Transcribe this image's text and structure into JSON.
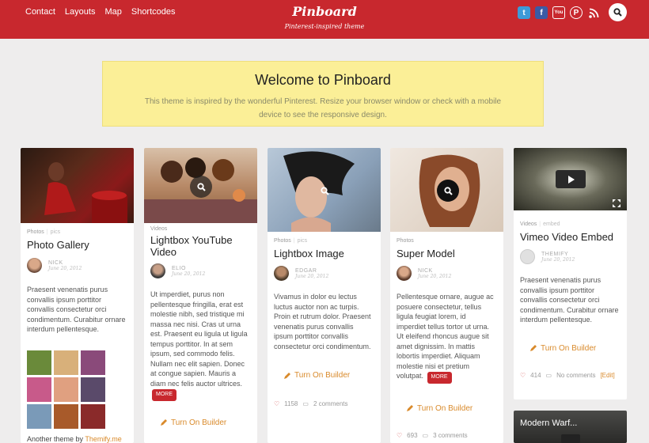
{
  "header": {
    "nav": [
      "Contact",
      "Layouts",
      "Map",
      "Shortcodes"
    ],
    "logo": "Pinboard",
    "tagline": "Pinterest-inspired theme",
    "social_icons": [
      "twitter-icon",
      "facebook-icon",
      "youtube-icon",
      "pinterest-icon",
      "rss-icon"
    ],
    "search_icon": "search-icon"
  },
  "welcome": {
    "title": "Welcome to Pinboard",
    "text": "This theme is inspired by the wonderful Pinterest. Resize your browser window or check with a mobile device to see the responsive design."
  },
  "colors": {
    "brand": "#c8282e",
    "accent": "#d98a2b",
    "welcome_bg": "#fbef97"
  },
  "cards": [
    {
      "category": "Photos",
      "subcategory": "pics",
      "title": "Photo Gallery",
      "author": "NICK",
      "date": "June 20, 2012",
      "body": "Praesent venenatis purus convallis ipsum porttitor convallis consectetur orci condimentum. Curabitur ornare interdum pellentesque.",
      "credit_prefix": "Another theme by",
      "credit_link": "Themify.me"
    },
    {
      "category": "Videos",
      "title": "Lightbox YouTube Video",
      "author": "ELIO",
      "date": "June 20, 2012",
      "body": "Ut imperdiet, purus non pellentesque fringilla, erat est molestie nibh, sed tristique mi massa nec nisi. Cras ut urna est. Praesent eu ligula ut ligula tempus porttitor. In at sem ipsum, sed commodo felis. Nullam nec elit sapien. Donec at congue sapien. Mauris a diam nec felis auctor ultrices.",
      "more": "MORE",
      "builder": "Turn On Builder"
    },
    {
      "category": "Photos",
      "subcategory": "pics",
      "title": "Lightbox Image",
      "author": "EDGAR",
      "date": "June 20, 2012",
      "body": "Vivamus in dolor eu lectus luctus auctor non ac turpis. Proin et rutrum dolor. Praesent venenatis purus convallis ipsum porttitor convallis consectetur orci condimentum.",
      "builder": "Turn On Builder",
      "likes": "1158",
      "comments": "2 comments"
    },
    {
      "category": "Photos",
      "title": "Super Model",
      "author": "NICK",
      "date": "June 20, 2012",
      "body": "Pellentesque ornare, augue ac posuere consectetur, tellus ligula feugiat lorem, id imperdiet tellus tortor ut urna. Ut eleifend rhoncus augue sit amet dignissim. In mattis lobortis imperdiet. Aliquam molestie nisi et pretium volutpat.",
      "more": "MORE",
      "builder": "Turn On Builder",
      "likes": "693",
      "comments": "3 comments"
    },
    {
      "category": "Videos",
      "subcategory": "embed",
      "title": "Vimeo Video Embed",
      "author": "THEMIFY",
      "date": "June 20, 2012",
      "body": "Praesent venenatis purus convallis ipsum porttitor convallis consectetur orci condimentum. Curabitur ornare interdum pellentesque.",
      "builder": "Turn On Builder",
      "likes": "414",
      "comments": "No comments",
      "edit": "[Edit]",
      "next_title": "Modern Warf..."
    }
  ]
}
